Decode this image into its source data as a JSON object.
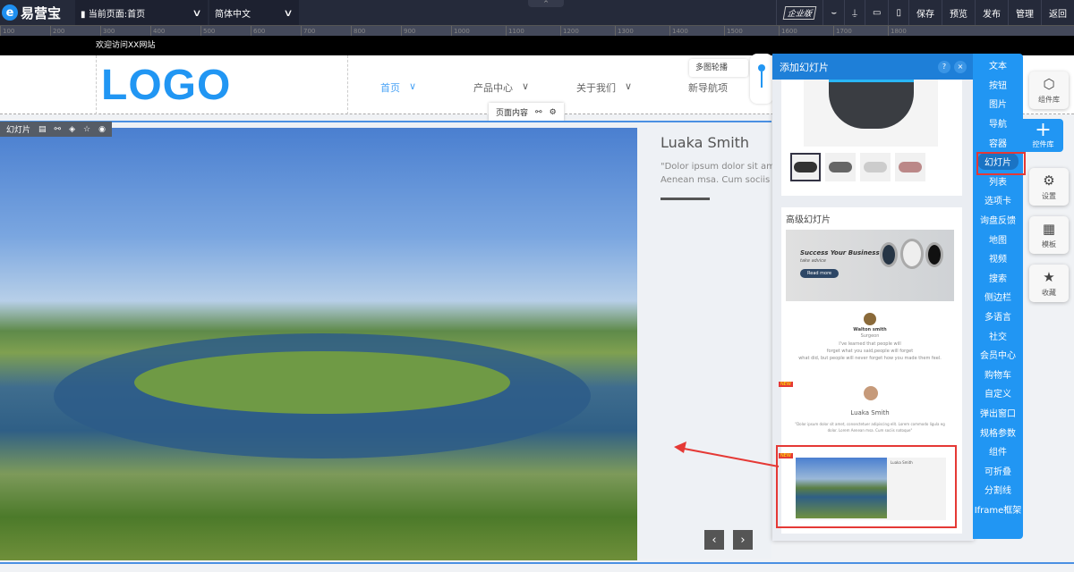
{
  "topbar": {
    "brand": "易营宝",
    "brand_icon": "e",
    "page_selector": "当前页面:首页",
    "language_selector": "简体中文",
    "edition_badge": "企业版",
    "buttons": {
      "save": "保存",
      "preview": "预览",
      "publish": "发布",
      "manage": "管理",
      "back": "返回"
    }
  },
  "ruler": [
    "100",
    "200",
    "300",
    "400",
    "500",
    "600",
    "700",
    "800",
    "900",
    "1000",
    "1100",
    "1200",
    "1300",
    "1400",
    "1500",
    "1600",
    "1700",
    "1800"
  ],
  "site": {
    "welcome": "欢迎访问XX网站",
    "logo": "LOGO",
    "nav": [
      {
        "label": "首页"
      },
      {
        "label": "产品中心"
      },
      {
        "label": "关于我们"
      },
      {
        "label": "新导航项"
      }
    ],
    "tooltip": "多图轮播",
    "page_content_label": "页面内容"
  },
  "slider": {
    "toolbar_label": "幻灯片",
    "name": "Luaka Smith",
    "body_line1": "\"Dolor ipsum dolor sit amet,",
    "body_line2": "Aenean msa. Cum sociis na",
    "prev": "‹",
    "next": "›"
  },
  "panel": {
    "title": "添加幻灯片",
    "help": "?",
    "close": "×",
    "section_title": "高级幻灯片",
    "banner_title": "Success Your Business",
    "banner_sub": "take advice",
    "banner_button": "Read more",
    "testimonial1": {
      "name": "Walton smith",
      "role": "Surgeon",
      "text1": "I've learned that people will",
      "text2": "forget what you said,people will forget",
      "text3": "what did, but people will never forget how you made them feel."
    },
    "testimonial2": {
      "name": "Luaka Smith",
      "text1": "\"Dolor ipsum dolor sit amet, consectetuer adipiscing elit. Lorem commodo ligula eg",
      "text2": "dolor. Lorem Aenean msa. Cum sociis natoque\""
    },
    "new_tag": "NEW",
    "preview_name": "Luaka Smith"
  },
  "categories": [
    "文本",
    "按钮",
    "图片",
    "导航",
    "容器",
    "幻灯片",
    "列表",
    "选项卡",
    "询盘反馈",
    "地图",
    "视频",
    "搜索",
    "侧边栏",
    "多语言",
    "社交",
    "会员中心",
    "购物车",
    "自定义",
    "弹出窗口",
    "规格参数",
    "组件",
    "可折叠",
    "分割线",
    "Iframe框架"
  ],
  "selected_category": "幻灯片",
  "float_buttons": {
    "component_lib": "组件库",
    "control_lib": "控件库",
    "settings": "设置",
    "template": "模板",
    "favorites": "收藏"
  },
  "colors": {
    "accent": "#2196f3",
    "topbar": "#252a3a",
    "highlight": "#e53935"
  }
}
